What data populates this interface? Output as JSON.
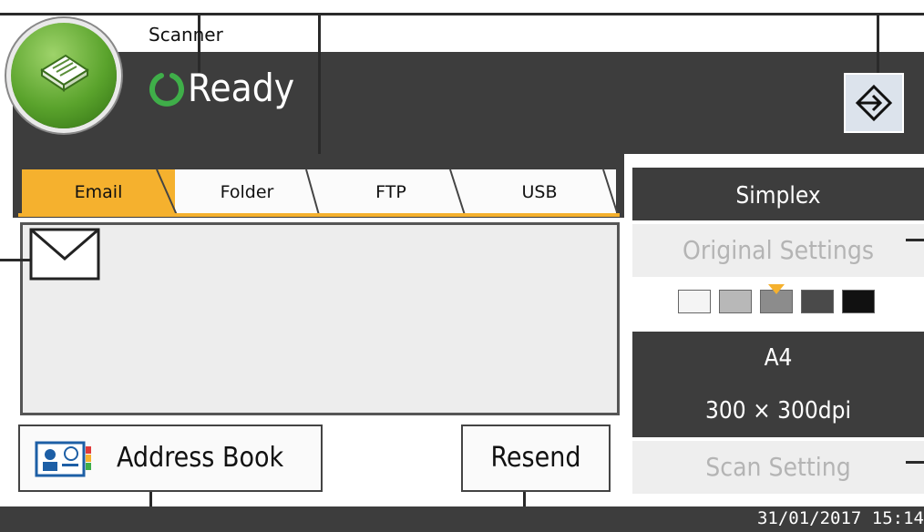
{
  "app": {
    "title": "Scanner",
    "status": "Ready",
    "app_icon": "scanner-icon",
    "status_icon": "ready-ring-icon",
    "logout_icon": "logout-icon"
  },
  "tabs": [
    {
      "label": "Email",
      "active": true
    },
    {
      "label": "Folder",
      "active": false
    },
    {
      "label": "FTP",
      "active": false
    },
    {
      "label": "USB",
      "active": false
    }
  ],
  "destination": {
    "icon": "envelope-icon"
  },
  "buttons": {
    "address_book": "Address Book",
    "address_book_icon": "address-book-icon",
    "resend": "Resend"
  },
  "settings": {
    "simplex": "Simplex",
    "original_settings": "Original Settings",
    "paper_size": "A4",
    "resolution": "300 × 300dpi",
    "scan_setting": "Scan Setting",
    "density_levels": [
      "#f4f4f4",
      "#b8b8b8",
      "#8c8c8c",
      "#4a4a4a",
      "#111111"
    ],
    "density_selected_index": 2
  },
  "statusbar": {
    "datetime": "31/01/2017 15:14"
  },
  "colors": {
    "accent": "#f5b12e",
    "panel_dark": "#3d3d3d",
    "disabled_text": "#b4b4b4",
    "ready_green": "#3fae49"
  }
}
